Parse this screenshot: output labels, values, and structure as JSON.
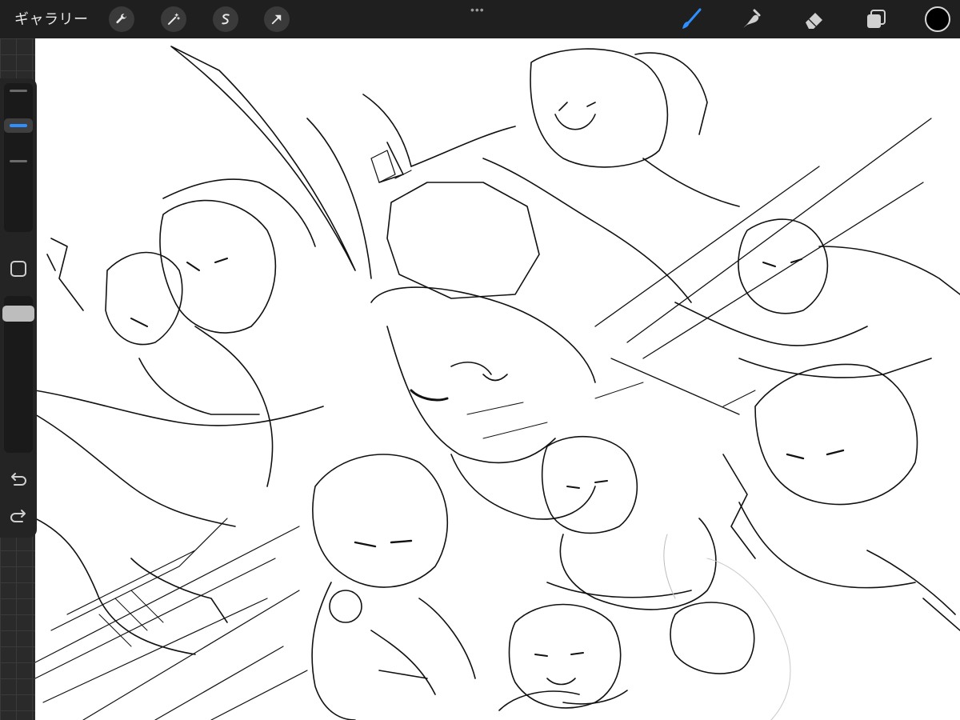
{
  "topbar": {
    "gallery_label": "ギャラリー",
    "left_tools": [
      "wrench-icon",
      "magic-wand-icon",
      "selection-icon",
      "transform-arrow-icon"
    ],
    "handle_dots": "•••",
    "right_tools": [
      "brush-icon",
      "smudge-icon",
      "eraser-icon",
      "layers-icon"
    ],
    "active_tool": "brush-icon",
    "color_swatch": "#000000"
  },
  "colors": {
    "accent": "#2f8fff",
    "topbar_bg": "#1f1f1f",
    "canvas_bg": "#ffffff",
    "stroke": "#111111"
  },
  "sidebar": {
    "brush_size_active": true,
    "opacity_label": "",
    "tools": [
      "brush-size-slider",
      "modify-button",
      "brush-opacity-slider",
      "undo-icon",
      "redo-icon"
    ]
  }
}
